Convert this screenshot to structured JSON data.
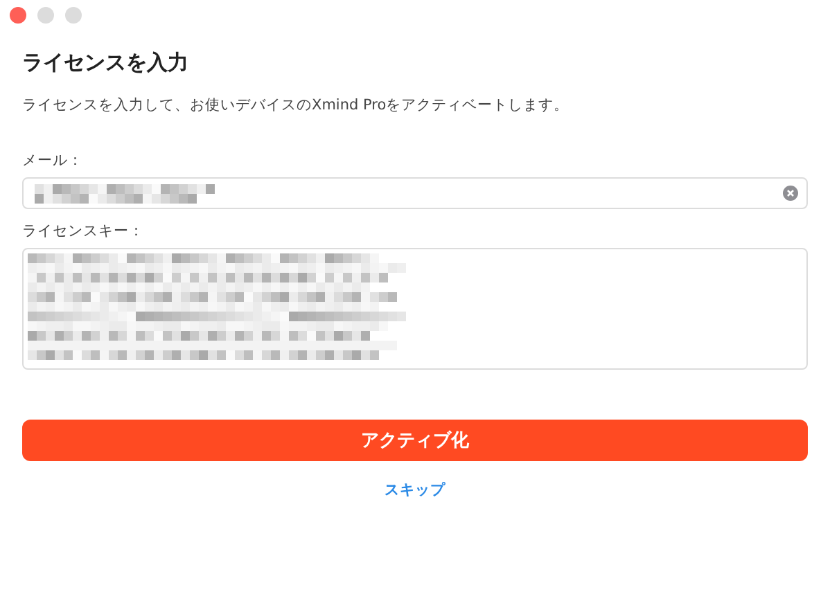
{
  "window": {
    "controls": [
      {
        "kind": "close"
      },
      {
        "kind": "inactive"
      },
      {
        "kind": "inactive"
      }
    ]
  },
  "title": "ライセンスを入力",
  "description": "ライセンスを入力して、お使いデバイスのXmind Proをアクティベートします。",
  "fields": [
    {
      "kind": "input",
      "label": "メール：",
      "redacted": true,
      "clearable": true
    },
    {
      "kind": "textarea",
      "label": "ライセンスキー：",
      "redacted": true,
      "clearable": false
    }
  ],
  "primary_button": "アクティブ化",
  "link": "スキップ"
}
